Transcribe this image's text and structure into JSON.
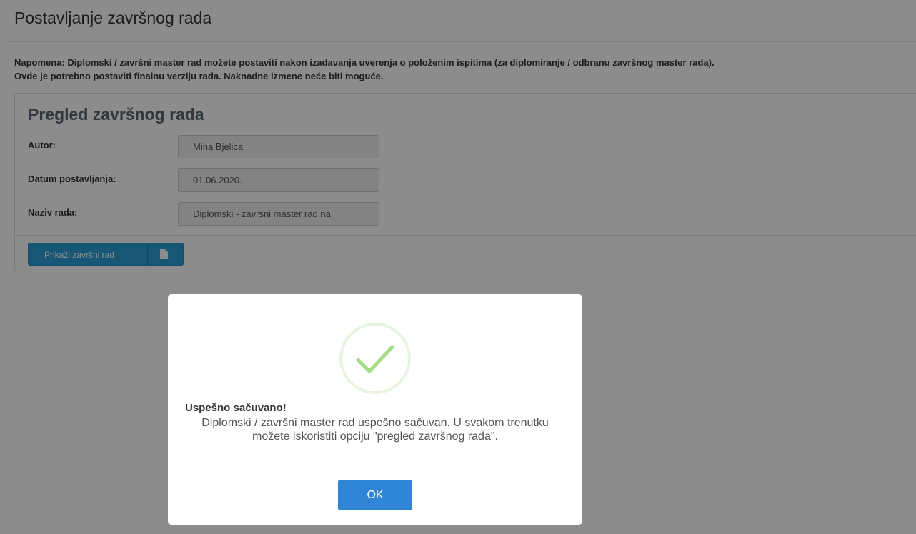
{
  "page": {
    "title": "Postavljanje završnog rada",
    "note_line1": "Napomena: Diplomski / završni master rad možete postaviti nakon izadavanja uverenja o položenim ispitima (za diplomiranje / odbranu završnog master rada).",
    "note_line2": "Ovde je potrebno postaviti finalnu verziju rada. Naknadne izmene neće biti moguće."
  },
  "panel": {
    "title": "Pregled završnog rada",
    "fields": [
      {
        "label": "Autor:",
        "value": "Mina Bjelica"
      },
      {
        "label": "Datum postavljanja:",
        "value": "01.06.2020."
      },
      {
        "label": "Naziv rada:",
        "value": "Diplomski - zavrsni master rad na"
      }
    ],
    "show_button": {
      "label": "Prikaži završni rad",
      "icon": "document-icon"
    }
  },
  "modal": {
    "icon": "success-check-icon",
    "title": "Uspešno sačuvano!",
    "text": "Diplomski / završni master rad uspešno sačuvan. U svakom trenutku možete iskoristiti opciju \"pregled završnog rada\".",
    "ok_label": "OK"
  },
  "colors": {
    "primary_button": "#3085d6",
    "info_button": "#2b9fd6",
    "success": "#a5dc86"
  }
}
